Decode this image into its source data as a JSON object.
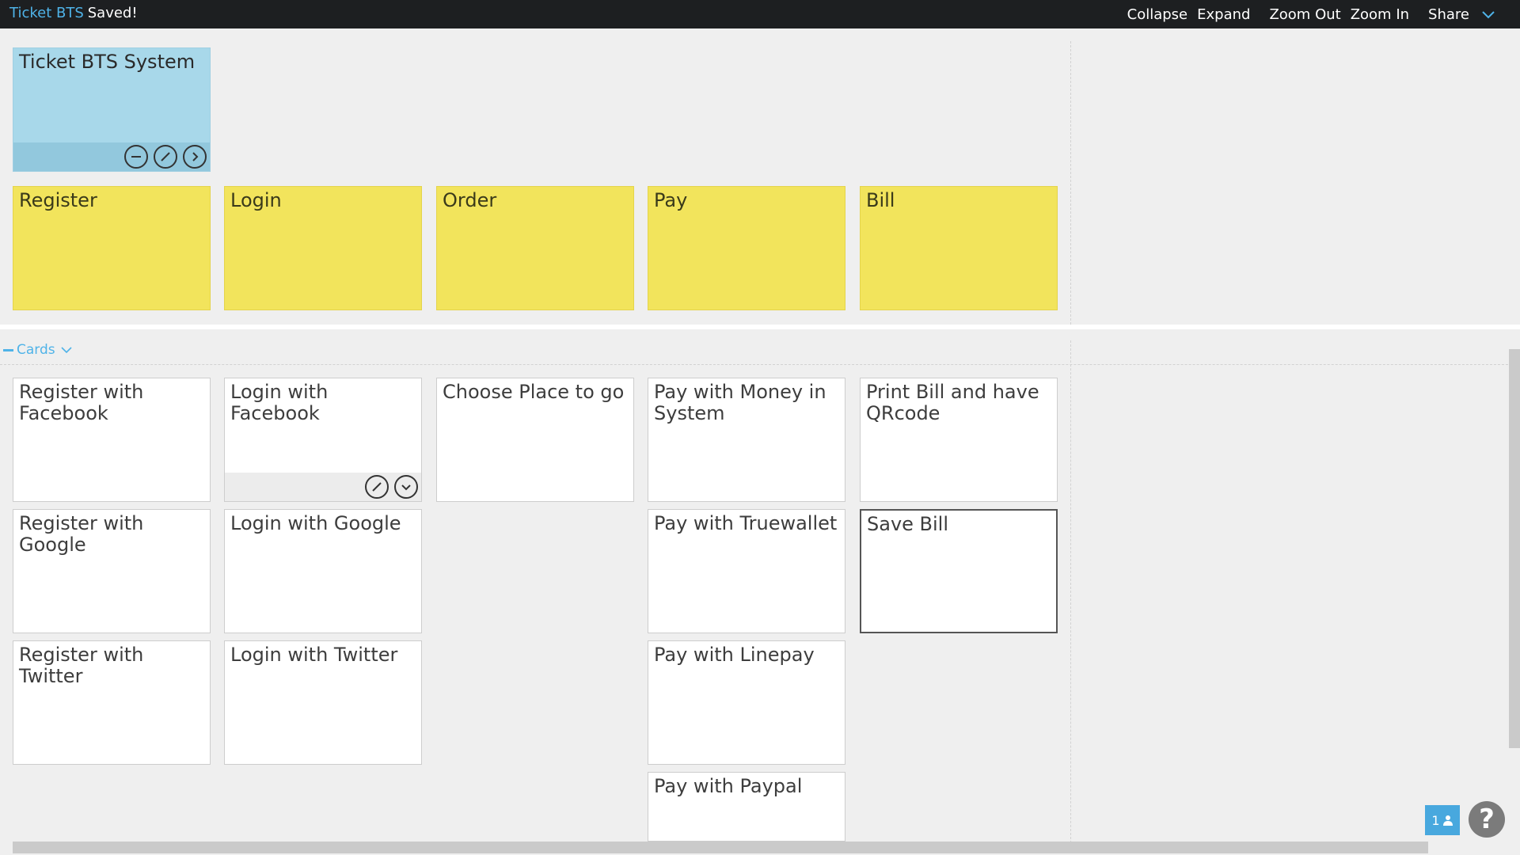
{
  "header": {
    "app_name": "Ticket BTS",
    "save_status": "Saved!",
    "nav": {
      "collapse": "Collapse",
      "expand": "Expand",
      "zoom_out": "Zoom Out",
      "zoom_in": "Zoom In",
      "share": "Share"
    }
  },
  "goal": {
    "title": "Ticket BTS System"
  },
  "activities": [
    "Register",
    "Login",
    "Order",
    "Pay",
    "Bill"
  ],
  "section": {
    "title": "Cards"
  },
  "columns": [
    [
      "Register with Facebook",
      "Register with Google",
      "Register with Twitter"
    ],
    [
      "Login with Facebook",
      "Login with Google",
      "Login with Twitter"
    ],
    [
      "Choose Place to go"
    ],
    [
      "Pay with Money in System",
      "Pay with Truewallet",
      "Pay with Linepay",
      "Pay with Paypal"
    ],
    [
      "Print Bill and have QRcode",
      "Save Bill"
    ]
  ],
  "footer": {
    "users_count": "1",
    "help_label": "?"
  },
  "colors": {
    "accent": "#4fb3e8",
    "topbar": "#1d1f21",
    "goal_card": "#a8d8ea",
    "activity_card": "#f2e45c",
    "task_card": "#ffffff"
  },
  "icons": [
    "minus-circle-icon",
    "edit-pencil-icon",
    "chevron-right-icon",
    "chevron-down-icon",
    "user-icon",
    "help-icon"
  ]
}
